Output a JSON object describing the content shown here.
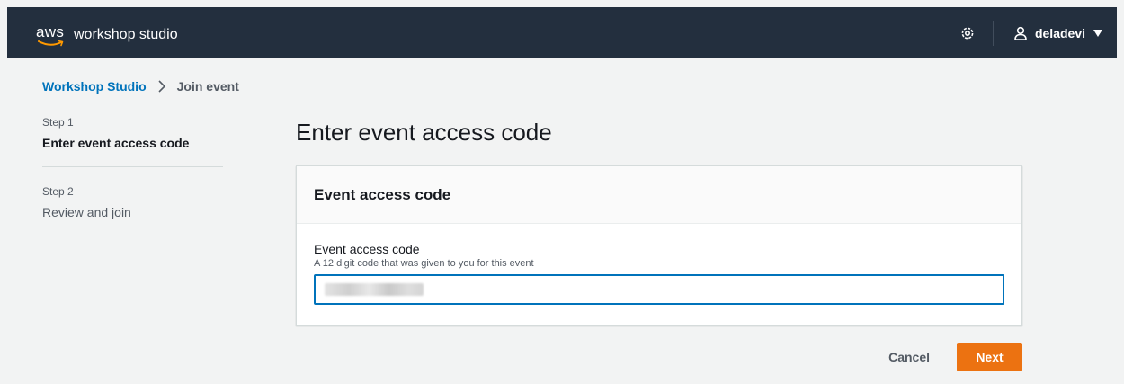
{
  "topbar": {
    "logo_text": "aws",
    "product_name": "workshop studio",
    "username": "deladevi",
    "icons": {
      "settings": "gear-icon",
      "user": "user-icon",
      "menu": "caret-down-icon"
    },
    "colors": {
      "background": "#232f3e",
      "smile": "#ff9900"
    }
  },
  "breadcrumb": {
    "root": "Workshop Studio",
    "current": "Join event"
  },
  "steps": [
    {
      "number": "Step 1",
      "title": "Enter event access code",
      "active": true
    },
    {
      "number": "Step 2",
      "title": "Review and join",
      "active": false
    }
  ],
  "main": {
    "title": "Enter event access code",
    "panel": {
      "header": "Event access code",
      "field": {
        "label": "Event access code",
        "description": "A 12 digit code that was given to you for this event",
        "value_obscured": true
      }
    }
  },
  "actions": {
    "cancel_label": "Cancel",
    "next_label": "Next",
    "primary_color": "#ec7211"
  }
}
